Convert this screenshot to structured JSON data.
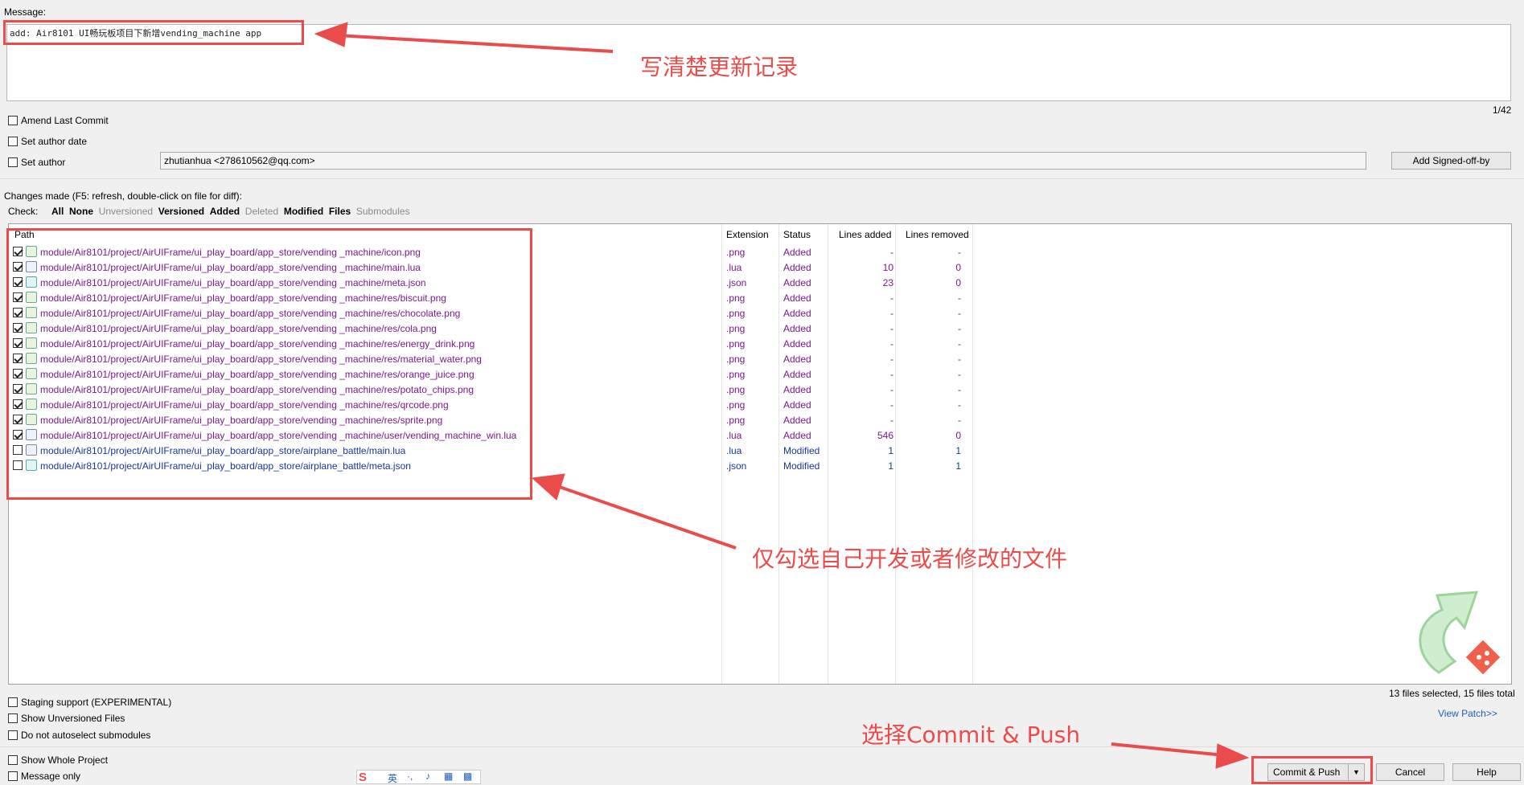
{
  "message": {
    "label": "Message:",
    "text": "add: Air8101 UI畅玩板项目下新增vending_machine app",
    "counter": "1/42"
  },
  "options": {
    "amend": "Amend Last Commit",
    "set_author_date": "Set author date",
    "set_author": "Set author",
    "author_value": "zhutianhua <278610562@qq.com>",
    "signed_off_button": "Add Signed-off-by"
  },
  "changes": {
    "header": "Changes made (F5: refresh, double-click on file for diff):",
    "check_label": "Check:",
    "filters": [
      "All",
      "None",
      "Unversioned",
      "Versioned",
      "Added",
      "Deleted",
      "Modified",
      "Files",
      "Submodules"
    ]
  },
  "table": {
    "columns": [
      "Path",
      "Extension",
      "Status",
      "Lines added",
      "Lines removed"
    ],
    "rows": [
      {
        "checked": true,
        "path": "module/Air8101/project/AirUIFrame/ui_play_board/app_store/vending _machine/icon.png",
        "ext": ".png",
        "status": "Added",
        "added": "-",
        "removed": "-",
        "icon": "png"
      },
      {
        "checked": true,
        "path": "module/Air8101/project/AirUIFrame/ui_play_board/app_store/vending _machine/main.lua",
        "ext": ".lua",
        "status": "Added",
        "added": "10",
        "removed": "0",
        "icon": "lua"
      },
      {
        "checked": true,
        "path": "module/Air8101/project/AirUIFrame/ui_play_board/app_store/vending _machine/meta.json",
        "ext": ".json",
        "status": "Added",
        "added": "23",
        "removed": "0",
        "icon": "json"
      },
      {
        "checked": true,
        "path": "module/Air8101/project/AirUIFrame/ui_play_board/app_store/vending _machine/res/biscuit.png",
        "ext": ".png",
        "status": "Added",
        "added": "-",
        "removed": "-",
        "icon": "png"
      },
      {
        "checked": true,
        "path": "module/Air8101/project/AirUIFrame/ui_play_board/app_store/vending _machine/res/chocolate.png",
        "ext": ".png",
        "status": "Added",
        "added": "-",
        "removed": "-",
        "icon": "png"
      },
      {
        "checked": true,
        "path": "module/Air8101/project/AirUIFrame/ui_play_board/app_store/vending _machine/res/cola.png",
        "ext": ".png",
        "status": "Added",
        "added": "-",
        "removed": "-",
        "icon": "png"
      },
      {
        "checked": true,
        "path": "module/Air8101/project/AirUIFrame/ui_play_board/app_store/vending _machine/res/energy_drink.png",
        "ext": ".png",
        "status": "Added",
        "added": "-",
        "removed": "-",
        "icon": "png"
      },
      {
        "checked": true,
        "path": "module/Air8101/project/AirUIFrame/ui_play_board/app_store/vending _machine/res/material_water.png",
        "ext": ".png",
        "status": "Added",
        "added": "-",
        "removed": "-",
        "icon": "png"
      },
      {
        "checked": true,
        "path": "module/Air8101/project/AirUIFrame/ui_play_board/app_store/vending _machine/res/orange_juice.png",
        "ext": ".png",
        "status": "Added",
        "added": "-",
        "removed": "-",
        "icon": "png"
      },
      {
        "checked": true,
        "path": "module/Air8101/project/AirUIFrame/ui_play_board/app_store/vending _machine/res/potato_chips.png",
        "ext": ".png",
        "status": "Added",
        "added": "-",
        "removed": "-",
        "icon": "png"
      },
      {
        "checked": true,
        "path": "module/Air8101/project/AirUIFrame/ui_play_board/app_store/vending _machine/res/qrcode.png",
        "ext": ".png",
        "status": "Added",
        "added": "-",
        "removed": "-",
        "icon": "png"
      },
      {
        "checked": true,
        "path": "module/Air8101/project/AirUIFrame/ui_play_board/app_store/vending _machine/res/sprite.png",
        "ext": ".png",
        "status": "Added",
        "added": "-",
        "removed": "-",
        "icon": "png"
      },
      {
        "checked": true,
        "path": "module/Air8101/project/AirUIFrame/ui_play_board/app_store/vending _machine/user/vending_machine_win.lua",
        "ext": ".lua",
        "status": "Added",
        "added": "546",
        "removed": "0",
        "icon": "lua"
      },
      {
        "checked": false,
        "path": "module/Air8101/project/AirUIFrame/ui_play_board/app_store/airplane_battle/main.lua",
        "ext": ".lua",
        "status": "Modified",
        "added": "1",
        "removed": "1",
        "icon": "lua"
      },
      {
        "checked": false,
        "path": "module/Air8101/project/AirUIFrame/ui_play_board/app_store/airplane_battle/meta.json",
        "ext": ".json",
        "status": "Modified",
        "added": "1",
        "removed": "1",
        "icon": "json"
      }
    ]
  },
  "bottom": {
    "staging": "Staging support (EXPERIMENTAL)",
    "show_unversioned": "Show Unversioned Files",
    "no_autoselect": "Do not autoselect submodules",
    "show_whole": "Show Whole Project",
    "message_only": "Message only",
    "selection_status": "13 files selected, 15 files total",
    "view_patch": "View Patch>>",
    "commit_push": "Commit & Push",
    "cancel": "Cancel",
    "help": "Help"
  },
  "annotations": {
    "message_tip": "写清楚更新记录",
    "files_tip": "仅勾选自己开发或者修改的文件",
    "commit_tip": "选择Commit & Push"
  },
  "ime_toolbar": {
    "mode": "英"
  },
  "colors": {
    "annotation_red": "#ea4b4b",
    "added_purple": "#7a1a8a",
    "modified_blue": "#1a35a0",
    "link_blue": "#1f5fbf"
  }
}
